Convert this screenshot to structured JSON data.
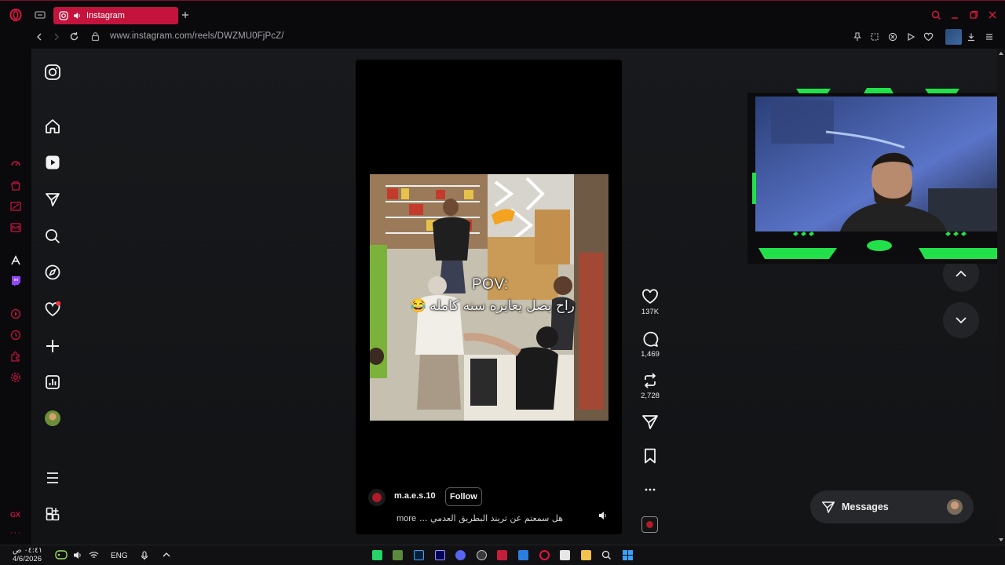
{
  "browser": {
    "tab_title": "Instagram",
    "url": "www.instagram.com/reels/DWZMU0FjPcZ/",
    "accent_color": "#c4143e"
  },
  "reel": {
    "username": "m.a.e.s.10",
    "follow_label": "Follow",
    "caption": "هل سمعتم عن تريند البطريق العدمي ...",
    "more_label": "more",
    "overlay_line1": "POV:",
    "overlay_line2": "راح يصل يعايره سنه كامله",
    "overlay_emoji": "😂",
    "likes": "137K",
    "comments": "1,469",
    "reposts": "2,728"
  },
  "messages_label": "Messages",
  "taskbar": {
    "time": "٠٤:٤١ ص",
    "date": "4/6/2026",
    "language": "ENG"
  },
  "gx_label": "GX"
}
